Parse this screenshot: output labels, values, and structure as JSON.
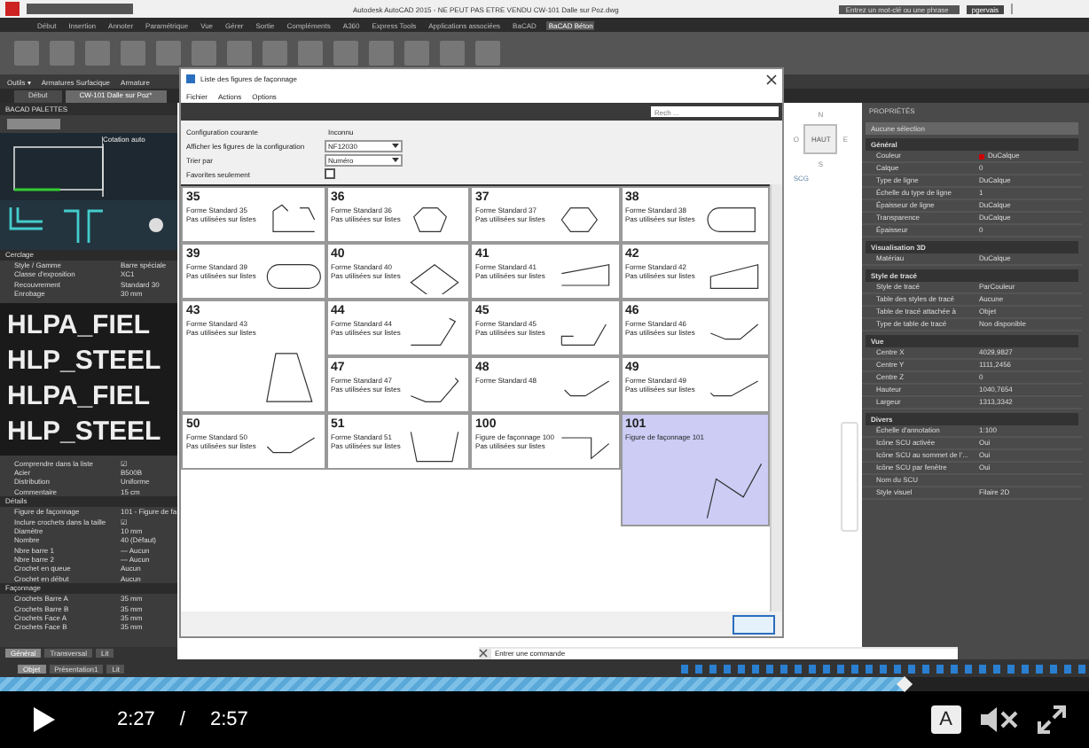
{
  "app": {
    "title": "Autodesk AutoCAD 2015 - NE PEUT PAS ETRE VENDU    CW-101 Dalle sur Poz.dwg",
    "search_placeholder": "Entrez un mot-clé ou une phrase",
    "user": "pgervais"
  },
  "ribbon_tabs": [
    {
      "label": "Début",
      "selected": false
    },
    {
      "label": "Insertion",
      "selected": false
    },
    {
      "label": "Annoter",
      "selected": false
    },
    {
      "label": "Paramétrique",
      "selected": false
    },
    {
      "label": "Vue",
      "selected": false
    },
    {
      "label": "Gérer",
      "selected": false
    },
    {
      "label": "Sortie",
      "selected": false
    },
    {
      "label": "Compléments",
      "selected": false
    },
    {
      "label": "A360",
      "selected": false
    },
    {
      "label": "Express Tools",
      "selected": false
    },
    {
      "label": "Applications associées",
      "selected": false
    },
    {
      "label": "BaCAD",
      "selected": false
    },
    {
      "label": "BaCAD Béton",
      "selected": true
    }
  ],
  "tool_row": [
    "Outils ▾",
    "Armatures Surfacique",
    "Armature"
  ],
  "doc_tabs": [
    {
      "label": "Début",
      "selected": false
    },
    {
      "label": "CW-101 Dalle sur Poz*",
      "selected": true
    }
  ],
  "left_palette": {
    "title": "BACAD PALETTES",
    "preview_label": "Cotation auto",
    "upper_sections": [
      {
        "title": "Cerclage",
        "rows": [
          {
            "label": "Style / Gamme",
            "value": "Barre spéciale"
          },
          {
            "label": "Classe d'exposition",
            "value": "XC1"
          },
          {
            "label": "Recouvrement",
            "value": "Standard 30"
          },
          {
            "label": "Enrobage",
            "value": "30 mm"
          }
        ]
      }
    ],
    "sections": [
      {
        "rows": [
          {
            "label": "Comprendre dans la liste",
            "value": "☑"
          },
          {
            "label": "Acier",
            "value": "B500B"
          },
          {
            "label": "Distribution",
            "value": "Uniforme"
          },
          {
            "label": "Commentaire",
            "value": "15 cm"
          }
        ]
      },
      {
        "title": "Détails",
        "rows": [
          {
            "label": "Figure de façonnage",
            "value": "101 - Figure de fa"
          },
          {
            "label": "Inclure crochets dans la taille",
            "value": "☑"
          },
          {
            "label": "Diamètre",
            "value": "10 mm"
          },
          {
            "label": "Nombre",
            "value": "40 (Défaut)"
          },
          {
            "label": "Nbre barre 1",
            "value": "— Aucun"
          },
          {
            "label": "Nbre barre 2",
            "value": "— Aucun"
          },
          {
            "label": "Crochet en queue",
            "value": "Aucun"
          },
          {
            "label": "Crochet en début",
            "value": "Aucun"
          }
        ]
      },
      {
        "title": "Façonnage",
        "rows": [
          {
            "label": "Crochets Barre A",
            "value": "35 mm"
          },
          {
            "label": "Crochets Barre B",
            "value": "35 mm"
          },
          {
            "label": "Crochets Face A",
            "value": "35 mm"
          },
          {
            "label": "Crochets Face B",
            "value": "35 mm"
          }
        ]
      }
    ],
    "tabs": [
      {
        "label": "Général",
        "selected": true
      },
      {
        "label": "Transversal",
        "selected": false
      },
      {
        "label": "Lit",
        "selected": false
      }
    ]
  },
  "overlay_labels": [
    "HLPA_FIEL",
    "HLP_STEEL",
    "HLPA_FIEL",
    "HLP_STEEL"
  ],
  "viewcube": {
    "face": "HAUT",
    "north": "N",
    "south": "S",
    "east": "E",
    "west": "O",
    "ucs": "SCG"
  },
  "dialog": {
    "title": "Liste des figures de façonnage",
    "menu": [
      "Fichier",
      "Actions",
      "Options"
    ],
    "search_placeholder": "Rech ...",
    "fields": [
      {
        "kind": "text",
        "label": "Configuration courante",
        "value": "Inconnu"
      },
      {
        "kind": "select",
        "label": "Afficher les figures de la configuration",
        "value": "NF12030"
      },
      {
        "kind": "select",
        "label": "Trier par",
        "value": "Numéro"
      },
      {
        "kind": "checkbox",
        "label": "Favorites seulement",
        "checked": false
      }
    ],
    "shapes": [
      {
        "number": "35",
        "lines": [
          "Forme Standard 35",
          "Pas utilisées sur listes"
        ],
        "selected": false
      },
      {
        "number": "36",
        "lines": [
          "Forme Standard 36",
          "Pas utilisées sur listes"
        ],
        "selected": false
      },
      {
        "number": "37",
        "lines": [
          "Forme Standard 37",
          "Pas utilisées sur listes"
        ],
        "selected": false
      },
      {
        "number": "38",
        "lines": [
          "Forme Standard 38",
          "Pas utilisées sur listes"
        ],
        "selected": false
      },
      {
        "number": "39",
        "lines": [
          "Forme Standard 39",
          "Pas utilisées sur listes"
        ],
        "selected": false
      },
      {
        "number": "40",
        "lines": [
          "Forme Standard 40",
          "Pas utilisées sur listes"
        ],
        "selected": false
      },
      {
        "number": "41",
        "lines": [
          "Forme Standard 41",
          "Pas utilisées sur listes"
        ],
        "selected": false
      },
      {
        "number": "42",
        "lines": [
          "Forme Standard 42",
          "Pas utilisées sur listes"
        ],
        "selected": false
      },
      {
        "number": "43",
        "lines": [
          "Forme Standard 43",
          "Pas utilisées sur listes"
        ],
        "rowspan": 2,
        "selected": false
      },
      {
        "number": "44",
        "lines": [
          "Forme Standard 44",
          "Pas utilisées sur listes"
        ],
        "selected": false
      },
      {
        "number": "45",
        "lines": [
          "Forme Standard 45",
          "Pas utilisées sur listes"
        ],
        "selected": false
      },
      {
        "number": "46",
        "lines": [
          "Forme Standard 46",
          "Pas utilisées sur listes"
        ],
        "selected": false
      },
      {
        "number": "47",
        "lines": [
          "Forme Standard 47",
          "Pas utilisées sur listes"
        ],
        "selected": false
      },
      {
        "number": "48",
        "lines": [
          "Forme Standard 48"
        ],
        "selected": false
      },
      {
        "number": "49",
        "lines": [
          "Forme Standard 49",
          "Pas utilisées sur listes"
        ],
        "selected": false
      },
      {
        "number": "50",
        "lines": [
          "Forme Standard 50",
          "Pas utilisées sur listes"
        ],
        "selected": false
      },
      {
        "number": "51",
        "lines": [
          "Forme Standard 51",
          "Pas utilisées sur listes"
        ],
        "selected": false
      },
      {
        "number": "100",
        "lines": [
          "Figure de façonnage 100",
          "Pas utilisées sur listes"
        ],
        "selected": false
      },
      {
        "number": "101",
        "lines": [
          "Figure de façonnage 101"
        ],
        "rowspan": 2,
        "selected": true
      }
    ]
  },
  "properties": {
    "title": "PROPRIÉTÉS",
    "selection": "Aucune sélection",
    "sections": [
      {
        "title": "Général",
        "rows": [
          {
            "label": "Couleur",
            "value": "DuCalque",
            "color": "#cc0000"
          },
          {
            "label": "Calque",
            "value": "0"
          },
          {
            "label": "Type de ligne",
            "value": "DuCalque"
          },
          {
            "label": "Échelle du type de ligne",
            "value": "1"
          },
          {
            "label": "Épaisseur de ligne",
            "value": "DuCalque"
          },
          {
            "label": "Transparence",
            "value": "DuCalque"
          },
          {
            "label": "Épaisseur",
            "value": "0"
          }
        ]
      },
      {
        "title": "Visualisation 3D",
        "rows": [
          {
            "label": "Matériau",
            "value": "DuCalque"
          }
        ]
      },
      {
        "title": "Style de tracé",
        "rows": [
          {
            "label": "Style de tracé",
            "value": "ParCouleur"
          },
          {
            "label": "Table des styles de tracé",
            "value": "Aucune"
          },
          {
            "label": "Table de tracé attachée à",
            "value": "Objet"
          },
          {
            "label": "Type de table de tracé",
            "value": "Non disponible"
          }
        ]
      },
      {
        "title": "Vue",
        "rows": [
          {
            "label": "Centre X",
            "value": "4029,9827"
          },
          {
            "label": "Centre Y",
            "value": "1111,2456"
          },
          {
            "label": "Centre Z",
            "value": "0"
          },
          {
            "label": "Hauteur",
            "value": "1040,7654"
          },
          {
            "label": "Largeur",
            "value": "1313,3342"
          }
        ]
      },
      {
        "title": "Divers",
        "rows": [
          {
            "label": "Échelle d'annotation",
            "value": "1:100"
          },
          {
            "label": "Icône SCU activée",
            "value": "Oui"
          },
          {
            "label": "Icône SCU au sommet de l'...",
            "value": "Oui"
          },
          {
            "label": "Icône SCU par fenêtre",
            "value": "Oui"
          },
          {
            "label": "Nom du SCU"
          },
          {
            "label": "Style visuel",
            "value": "Filaire 2D"
          }
        ]
      }
    ]
  },
  "command_line": {
    "placeholder": "Entrer une commande"
  },
  "layout_tabs": [
    {
      "label": "Objet",
      "selected": true
    },
    {
      "label": "Présentation1",
      "selected": false
    },
    {
      "label": "Lit",
      "selected": false
    }
  ],
  "player": {
    "playing": false,
    "level": 0.83,
    "current": "2:27",
    "separator": "/",
    "duration": "2:57",
    "captions": "A",
    "muted": true
  }
}
